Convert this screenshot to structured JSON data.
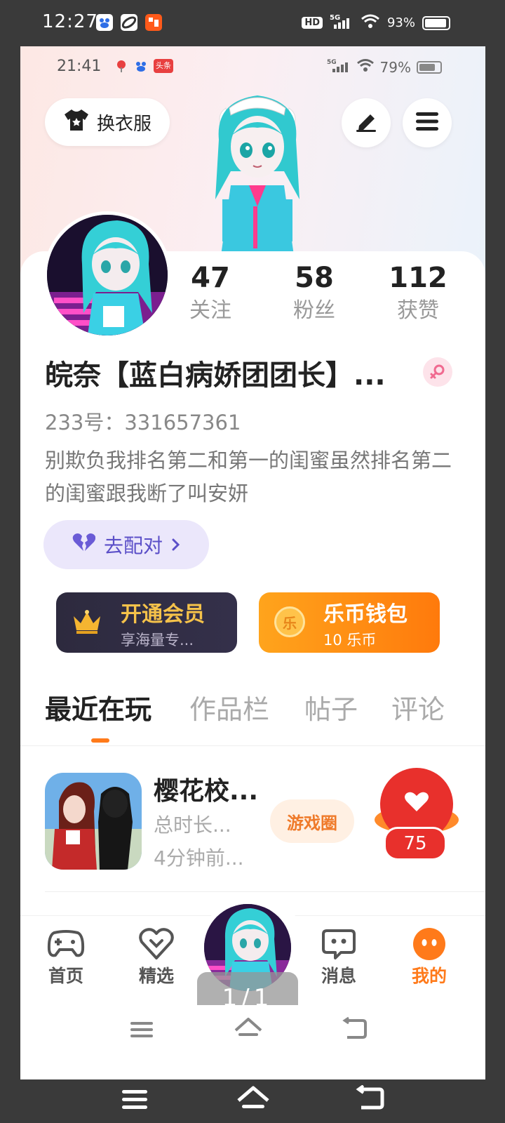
{
  "outer_status": {
    "time": "12:27",
    "network": "5G",
    "hd": "HD",
    "battery": "93%",
    "battery_level": 0.93
  },
  "inner_status": {
    "time": "21:41",
    "network": "5G",
    "battery": "79%",
    "battery_level": 0.79,
    "toutiao": "头条"
  },
  "header": {
    "dress_label": "换衣服",
    "edit_icon": "edit-icon",
    "menu_icon": "menu-icon"
  },
  "stats": [
    {
      "value": "47",
      "label": "关注"
    },
    {
      "value": "58",
      "label": "粉丝"
    },
    {
      "value": "112",
      "label": "获赞"
    }
  ],
  "profile": {
    "nickname": "皖奈【蓝白病娇团团长】...",
    "gender": "female",
    "uid": "233号：331657361",
    "bio": "别欺负我排名第二和第一的闺蜜虽然排名第二的闺蜜跟我断了叫安妍",
    "match_label": "去配对"
  },
  "vip": {
    "title": "开通会员",
    "subtitle": "享海量专..."
  },
  "wallet": {
    "title": "乐币钱包",
    "subtitle": "10 乐币",
    "coin_glyph": "乐"
  },
  "tabs": [
    {
      "label": "最近在玩",
      "active": true
    },
    {
      "label": "作品栏",
      "active": false
    },
    {
      "label": "帖子",
      "active": false
    },
    {
      "label": "评论",
      "active": false
    }
  ],
  "recent_game": {
    "name": "樱花校...",
    "duration": "总时长...",
    "last_played": "4分钟前...",
    "circle_label": "游戏圈",
    "likes": "75"
  },
  "bottom_nav": [
    {
      "label": "首页",
      "icon": "gamepad-icon"
    },
    {
      "label": "精选",
      "icon": "heart-shield-icon"
    },
    {
      "label": "消息",
      "icon": "chat-icon"
    },
    {
      "label": "我的",
      "icon": "face-icon",
      "active": true
    }
  ],
  "page_indicator": "1/1",
  "colors": {
    "accent": "#ff7a1a",
    "like_red": "#e8302c",
    "match_purple": "#5b4fc8",
    "vip_gold": "#f5c24a"
  }
}
